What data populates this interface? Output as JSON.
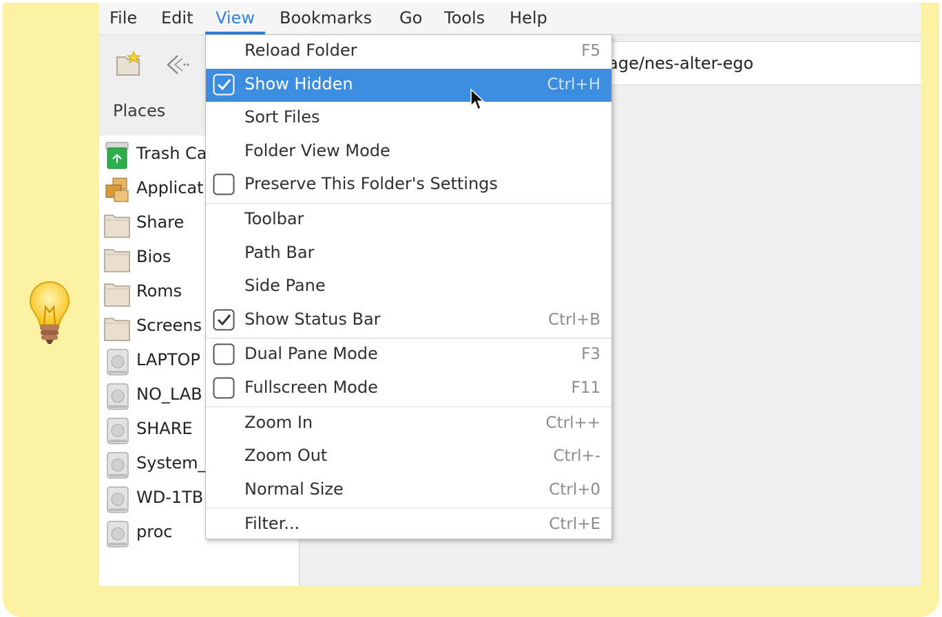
{
  "menubar": {
    "items": [
      "File",
      "Edit",
      "View",
      "Bookmarks",
      "Go",
      "Tools",
      "Help"
    ],
    "active": "View"
  },
  "path_bar": {
    "value": "age/nes-alter-ego"
  },
  "places": {
    "header": "Places",
    "items": [
      {
        "label": "Trash Ca",
        "icon": "trash-icon"
      },
      {
        "label": "Applicat",
        "icon": "applications-icon"
      },
      {
        "label": "Share",
        "icon": "folder-icon"
      },
      {
        "label": "Bios",
        "icon": "folder-icon"
      },
      {
        "label": "Roms",
        "icon": "folder-icon"
      },
      {
        "label": "Screens",
        "icon": "folder-icon"
      },
      {
        "label": "LAPTOP",
        "icon": "drive-icon"
      },
      {
        "label": "NO_LAB",
        "icon": "drive-icon"
      },
      {
        "label": "SHARE",
        "icon": "drive-icon"
      },
      {
        "label": "System_",
        "icon": "drive-icon"
      },
      {
        "label": "WD-1TB",
        "icon": "drive-icon"
      },
      {
        "label": "proc",
        "icon": "drive-icon"
      }
    ]
  },
  "view_menu": {
    "items": [
      {
        "label": "Reload Folder",
        "shortcut": "F5",
        "check": "none"
      },
      {
        "label": "Show Hidden",
        "shortcut": "Ctrl+H",
        "check": "checked",
        "highlighted": true
      },
      {
        "label": "Sort Files",
        "shortcut": "",
        "check": "none"
      },
      {
        "label": "Folder View Mode",
        "shortcut": "",
        "check": "none"
      },
      {
        "label": "Preserve This Folder's Settings",
        "shortcut": "",
        "check": "unchecked"
      },
      {
        "label": "Toolbar",
        "shortcut": "",
        "check": "none"
      },
      {
        "label": "Path Bar",
        "shortcut": "",
        "check": "none"
      },
      {
        "label": "Side Pane",
        "shortcut": "",
        "check": "none"
      },
      {
        "label": "Show Status Bar",
        "shortcut": "Ctrl+B",
        "check": "checked"
      },
      {
        "label": "Dual Pane Mode",
        "shortcut": "F3",
        "check": "unchecked"
      },
      {
        "label": "Fullscreen Mode",
        "shortcut": "F11",
        "check": "unchecked"
      },
      {
        "label": "Zoom In",
        "shortcut": "Ctrl++",
        "check": "none"
      },
      {
        "label": "Zoom Out",
        "shortcut": "Ctrl+-",
        "check": "none"
      },
      {
        "label": "Normal Size",
        "shortcut": "Ctrl+0",
        "check": "none"
      },
      {
        "label": "Filter...",
        "shortcut": "Ctrl+E",
        "check": "none"
      }
    ]
  },
  "colors": {
    "accent": "#3c8ce0",
    "frame": "#fdf2a4"
  }
}
